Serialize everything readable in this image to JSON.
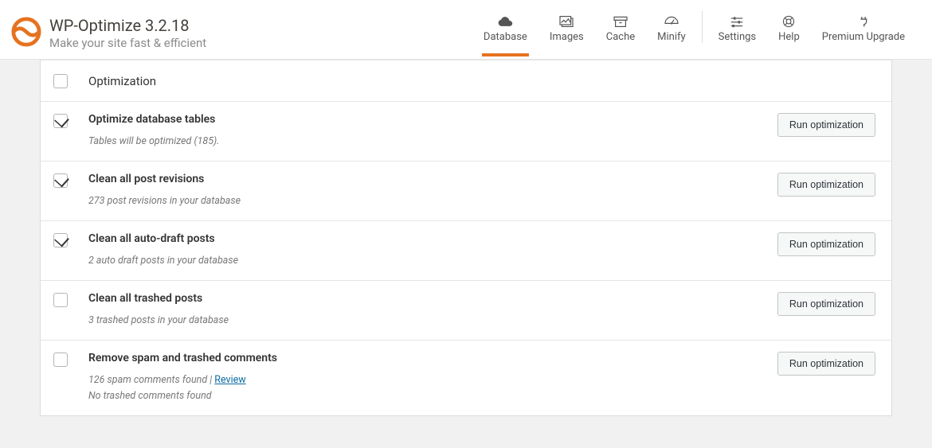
{
  "brand": {
    "title": "WP-Optimize 3.2.18",
    "tagline": "Make your site fast & efficient"
  },
  "tabs": {
    "database": "Database",
    "images": "Images",
    "cache": "Cache",
    "minify": "Minify",
    "settings": "Settings",
    "help": "Help",
    "premium": "Premium Upgrade"
  },
  "table": {
    "header": "Optimization",
    "run_label": "Run optimization",
    "review_label": "Review",
    "rows": [
      {
        "checked": true,
        "title": "Optimize database tables",
        "sub": "Tables will be optimized (185)."
      },
      {
        "checked": true,
        "title": "Clean all post revisions",
        "sub": "273 post revisions in your database"
      },
      {
        "checked": true,
        "title": "Clean all auto-draft posts",
        "sub": "2 auto draft posts in your database"
      },
      {
        "checked": false,
        "title": "Clean all trashed posts",
        "sub": "3 trashed posts in your database"
      },
      {
        "checked": false,
        "title": "Remove spam and trashed comments",
        "sub": "126 spam comments found | ",
        "review": true,
        "sub2": "No trashed comments found"
      }
    ]
  }
}
